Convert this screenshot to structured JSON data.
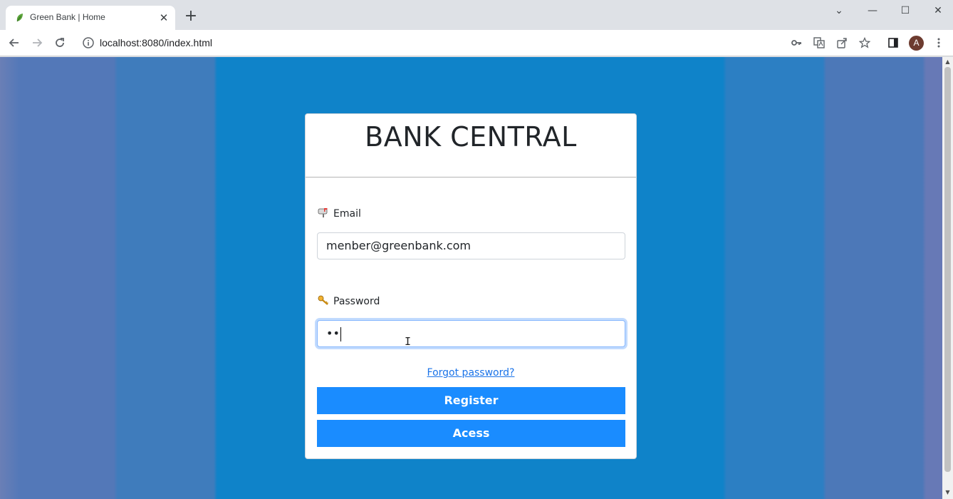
{
  "browser": {
    "tab_title": "Green Bank | Home",
    "tab_close": "✕",
    "new_tab": "+",
    "url": "localhost:8080/index.html",
    "avatar_initial": "A",
    "window_controls": {
      "menu": "⌄",
      "minimize": "—",
      "maximize": "☐",
      "close": "✕"
    }
  },
  "page": {
    "title": "BANK CENTRAL",
    "email": {
      "label": "Email",
      "icon": "mailbox-icon",
      "value": "menber@greenbank.com"
    },
    "password": {
      "label": "Password",
      "icon": "key-icon",
      "value": "••"
    },
    "forgot_link": "Forgot password?",
    "register_button": "Register",
    "access_button": "Acess"
  },
  "colors": {
    "accent": "#1a8cff",
    "link": "#1a73e8",
    "page_bg": "#0f83c9"
  }
}
